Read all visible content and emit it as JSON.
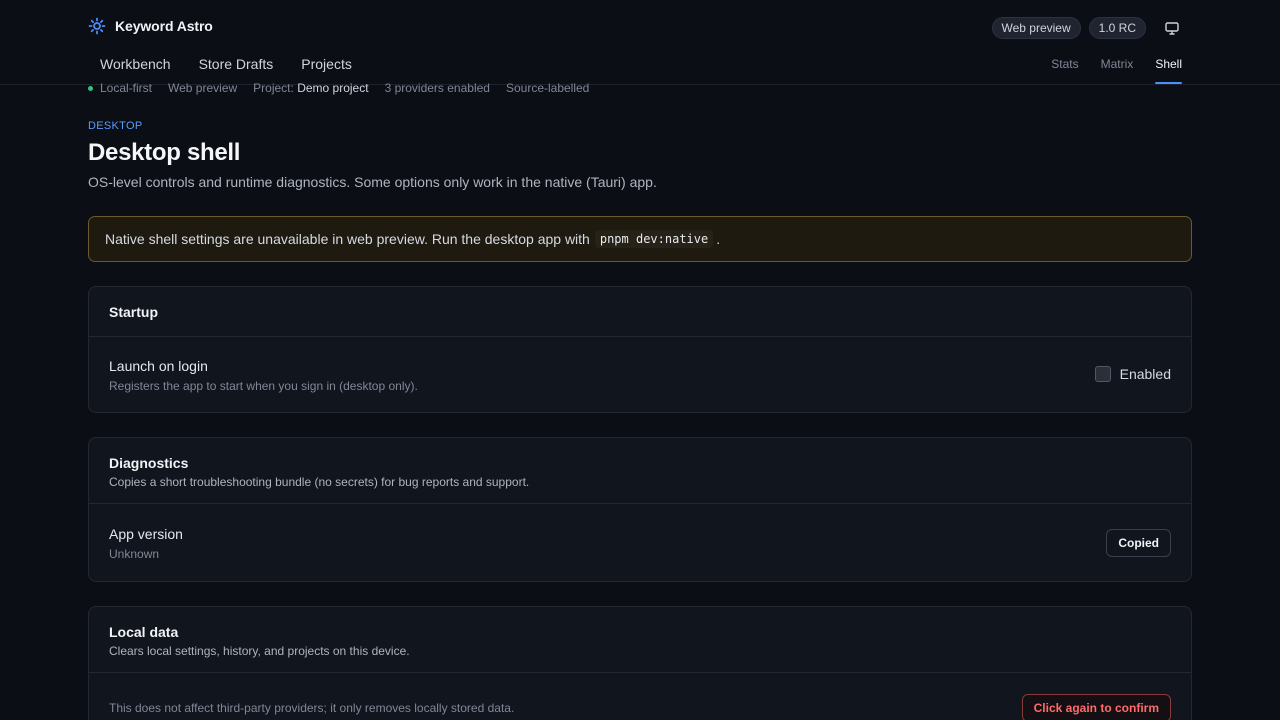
{
  "app": {
    "name": "Keyword Astro"
  },
  "header": {
    "badges": [
      "Web preview",
      "1.0 RC"
    ],
    "monitor_icon": "monitor-icon",
    "brand_icon": "sun-gear-icon"
  },
  "main_nav": [
    {
      "label": "Workbench"
    },
    {
      "label": "Store Drafts"
    },
    {
      "label": "Projects"
    }
  ],
  "sub_nav": [
    {
      "label": "Stats",
      "active": false
    },
    {
      "label": "Matrix",
      "active": false
    },
    {
      "label": "Shell",
      "active": true
    }
  ],
  "status": {
    "local": "Local-first",
    "mode": "Web preview",
    "project_label": "Project:",
    "project_value": "Demo project",
    "providers": "3 providers enabled",
    "sources": "Source-labelled",
    "dot_color": "#35c27a"
  },
  "page": {
    "eyebrow": "DESKTOP",
    "title": "Desktop shell",
    "subtitle": "OS-level controls and runtime diagnostics. Some options only work in the native (Tauri) app."
  },
  "banner": {
    "text": "Native shell settings are unavailable in web preview. Run the desktop app with",
    "code": "pnpm dev:native",
    "suffix": "."
  },
  "startup": {
    "title": "Startup",
    "row_title": "Launch on login",
    "row_sub": "Registers the app to start when you sign in (desktop only).",
    "checkbox_label": "Enabled",
    "checked": false
  },
  "diagnostics": {
    "title": "Diagnostics",
    "desc": "Copies a short troubleshooting bundle (no secrets) for bug reports and support.",
    "row_title": "App version",
    "row_sub": "Unknown",
    "button": "Copied"
  },
  "local_data": {
    "title": "Local data",
    "desc": "Clears local settings, history, and projects on this device.",
    "row_sub": "This does not affect third-party providers; it only removes locally stored data.",
    "button": "Click again to confirm"
  },
  "colors": {
    "accent": "#4c8dff",
    "danger": "#ff6b6b",
    "warning_border": "#6b5a2a"
  }
}
